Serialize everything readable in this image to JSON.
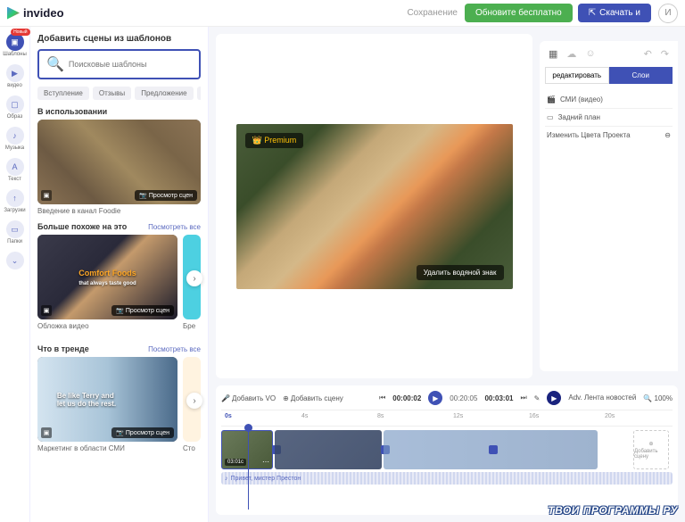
{
  "topbar": {
    "brand": "invideo",
    "status": "Сохранение",
    "upgrade": "Обновите бесплатно",
    "download": "Скачать и",
    "avatar": "И"
  },
  "leftnav": [
    {
      "label": "Шаблоны",
      "badge": "Новый",
      "active": true
    },
    {
      "label": "видео"
    },
    {
      "label": "Образ"
    },
    {
      "label": "Музыка"
    },
    {
      "label": "Текст"
    },
    {
      "label": "Загрузки"
    },
    {
      "label": "Папки"
    }
  ],
  "panel": {
    "title": "Добавить сцены из шаблонов",
    "search_placeholder": "Поисковые шаблоны",
    "chips": [
      "Вступление",
      "Отзывы",
      "Предложение",
      "С"
    ],
    "sec1": {
      "title": "В использовании",
      "preview": "Просмотр сцен",
      "caption": "Введение в канал Foodie"
    },
    "sec2": {
      "title": "Больше похоже на это",
      "link": "Посмотреть все",
      "overlay_line1": "Comfort Foods",
      "overlay_line2": "that always taste good",
      "preview": "Просмотр сцен",
      "caption1": "Обложка видео",
      "caption2": "Бре"
    },
    "sec3": {
      "title": "Что в тренде",
      "link": "Посмотреть все",
      "overlay_line1": "Be like Terry and",
      "overlay_line2": "let us do the rest.",
      "preview": "Просмотр сцен",
      "caption1": "Маркетинг в области СМИ",
      "caption2": "Сто"
    }
  },
  "canvas": {
    "premium": "Premium",
    "watermark": "Удалить водяной знак"
  },
  "rightpanel": {
    "tab_edit": "редактировать",
    "tab_layers": "Слои",
    "items": [
      {
        "label": "СМИ (видео)"
      },
      {
        "label": "Задний план"
      },
      {
        "label": "Изменить Цвета Проекта"
      }
    ]
  },
  "timeline": {
    "add_vo": "Добавить VO",
    "add_scene": "Добавить сцену",
    "time_cur": "00:00:02",
    "time_mid": "00:20:05",
    "time_total": "00:03:01",
    "adv": "Adv. Лента новостей",
    "zoom": "100%",
    "ticks": [
      "0s",
      "4s",
      "8s",
      "12s",
      "16s",
      "20s"
    ],
    "clip_dur": "03:01с",
    "add_scene_btn": "Добавить сцену",
    "audio": "Привет, мистер Престон"
  },
  "watermark_site": "ТВОИ ПРОГРАММЫ РУ"
}
